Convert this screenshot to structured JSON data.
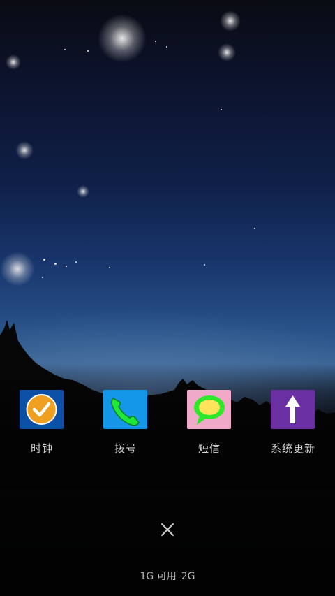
{
  "apps": [
    {
      "label": "时钟",
      "icon": "clock-check-icon",
      "color": "#0c4fa6"
    },
    {
      "label": "拨号",
      "icon": "phone-icon",
      "color": "#1497e8"
    },
    {
      "label": "短信",
      "icon": "message-bubble-icon",
      "color": "#f0a9c8"
    },
    {
      "label": "系统更新",
      "icon": "update-arrow-icon",
      "color": "#6a2fa0"
    }
  ],
  "memory": {
    "used": "1G 可用",
    "total": "2G"
  },
  "close": {
    "icon": "close-icon"
  }
}
